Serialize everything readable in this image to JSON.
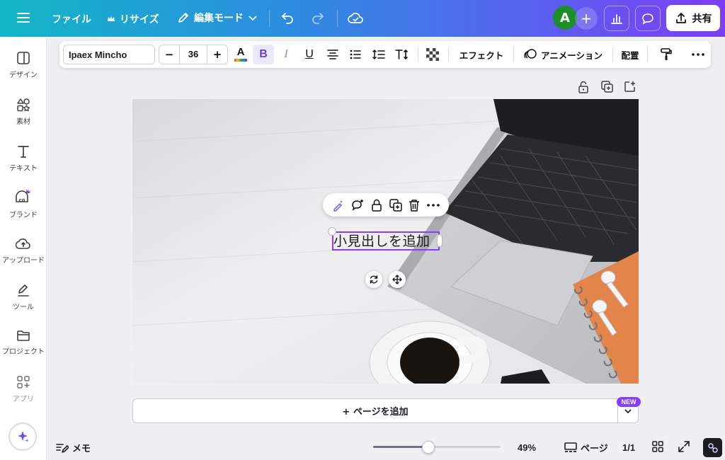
{
  "topbar": {
    "file": "ファイル",
    "resize": "リサイズ",
    "edit_mode": "編集モード",
    "avatar_initial": "A",
    "share": "共有"
  },
  "sidebar": {
    "items": [
      {
        "label": "デザイン",
        "icon": "design-icon"
      },
      {
        "label": "素材",
        "icon": "elements-icon"
      },
      {
        "label": "テキスト",
        "icon": "text-icon"
      },
      {
        "label": "ブランド",
        "icon": "brand-icon"
      },
      {
        "label": "アップロード",
        "icon": "upload-icon"
      },
      {
        "label": "ツール",
        "icon": "tools-icon"
      },
      {
        "label": "プロジェクト",
        "icon": "folder-icon"
      },
      {
        "label": "アプリ",
        "icon": "apps-icon"
      }
    ]
  },
  "toolbar": {
    "font_name": "Ipaex Mincho",
    "font_size": "36",
    "minus": "−",
    "plus": "+",
    "text_color_letter": "A",
    "bold": "B",
    "italic": "I",
    "underline": "U",
    "effects": "エフェクト",
    "animate": "アニメーション",
    "position": "配置"
  },
  "canvas": {
    "text": "小見出しを追加"
  },
  "add_page": {
    "label": "+ ページを追加",
    "badge": "NEW"
  },
  "bottom": {
    "notes": "メモ",
    "zoom_value": 49,
    "zoom": "49%",
    "pages_label": "ページ",
    "page_count": "1/1"
  },
  "colors": {
    "accent": "#8b3dff",
    "avatar": "#1a8f2a",
    "notebook": "#e3844a"
  }
}
